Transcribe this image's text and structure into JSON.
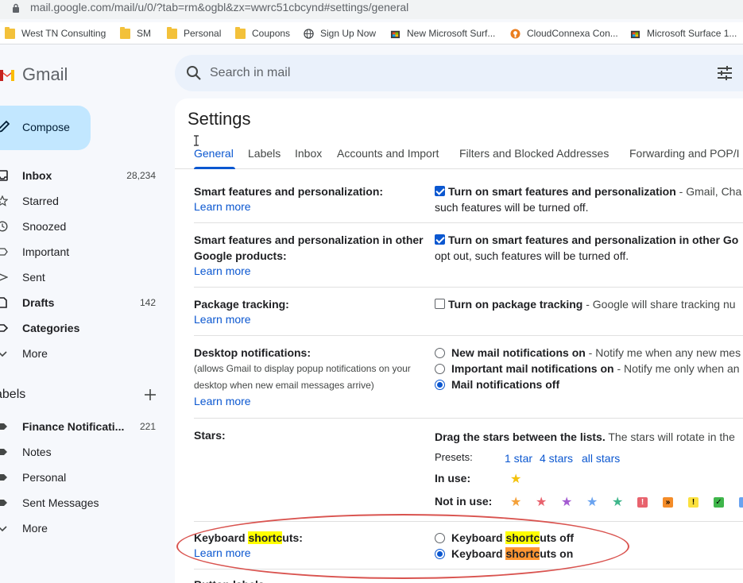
{
  "browser": {
    "url": "mail.google.com/mail/u/0/?tab=rm&ogbl&zx=wwrc51cbcynd#settings/general",
    "bookmarks": [
      {
        "label": "West TN Consulting",
        "icon": "folder-icon"
      },
      {
        "label": "SM",
        "icon": "folder-icon"
      },
      {
        "label": "Personal",
        "icon": "folder-icon"
      },
      {
        "label": "Coupons",
        "icon": "folder-icon"
      },
      {
        "label": "Sign Up Now",
        "icon": "globe-icon"
      },
      {
        "label": "New Microsoft Surf...",
        "icon": "microsoft-store-icon"
      },
      {
        "label": "CloudConnexa Con...",
        "icon": "openvpn-icon"
      },
      {
        "label": "Microsoft Surface 1...",
        "icon": "microsoft-store-icon"
      }
    ]
  },
  "header": {
    "logo_text": "Gmail",
    "search_placeholder": "Search in mail"
  },
  "sidebar": {
    "compose_label": "Compose",
    "items": [
      {
        "label": "Inbox",
        "count": "28,234",
        "bold": true,
        "icon": "inbox-icon"
      },
      {
        "label": "Starred",
        "count": "",
        "bold": false,
        "icon": "star-icon"
      },
      {
        "label": "Snoozed",
        "count": "",
        "bold": false,
        "icon": "clock-icon"
      },
      {
        "label": "Important",
        "count": "",
        "bold": false,
        "icon": "important-icon"
      },
      {
        "label": "Sent",
        "count": "",
        "bold": false,
        "icon": "send-icon"
      },
      {
        "label": "Drafts",
        "count": "142",
        "bold": true,
        "icon": "draft-icon"
      },
      {
        "label": "Categories",
        "count": "",
        "bold": true,
        "icon": "label-icon"
      },
      {
        "label": "More",
        "count": "",
        "bold": false,
        "icon": "chevron-down-icon"
      }
    ],
    "labels_heading": "abels",
    "labels": [
      {
        "label": "Finance Notificati...",
        "count": "221",
        "bold": true
      },
      {
        "label": "Notes",
        "count": "",
        "bold": false
      },
      {
        "label": "Personal",
        "count": "",
        "bold": false
      },
      {
        "label": "Sent Messages",
        "count": "",
        "bold": false
      },
      {
        "label": "More",
        "count": "",
        "bold": false
      }
    ]
  },
  "settings": {
    "title": "Settings",
    "tabs": [
      "General",
      "Labels",
      "Inbox",
      "Accounts and Import",
      "Filters and Blocked Addresses",
      "Forwarding and POP/I"
    ],
    "active_tab": "General",
    "learn_more": "Learn more",
    "smart": {
      "label": "Smart features and personalization:",
      "option_bold": "Turn on smart features and personalization",
      "option_rest": " - Gmail, Cha",
      "line2": "such features will be turned off."
    },
    "smart_other": {
      "label_line1": "Smart features and personalization in other",
      "label_line2": "Google products:",
      "option_bold": "Turn on smart features and personalization in other Go",
      "line2": "opt out, such features will be turned off."
    },
    "package": {
      "label": "Package tracking:",
      "option_bold": "Turn on package tracking",
      "option_rest": " - Google will share tracking nu"
    },
    "desktop": {
      "label": "Desktop notifications:",
      "sub_line1": "(allows Gmail to display popup notifications on your",
      "sub_line2": "desktop when new email messages arrive)",
      "opt1_bold": "New mail notifications on",
      "opt1_rest": " - Notify me when any new mes",
      "opt2_bold": "Important mail notifications on",
      "opt2_rest": " - Notify me only when an",
      "opt3_bold": "Mail notifications off"
    },
    "stars": {
      "label": "Stars:",
      "desc_bold": "Drag the stars between the lists.",
      "desc_rest": "  The stars will rotate in the",
      "presets_label": "Presets:",
      "presets": [
        "1 star",
        "4 stars",
        "all stars"
      ],
      "in_use_label": "In use:",
      "not_in_use_label": "Not in use:",
      "badge_glyphs": [
        "!",
        "»",
        "!",
        "✓"
      ]
    },
    "shortcuts": {
      "label_pre": "Keyboard ",
      "label_hl": "shortc",
      "label_post": "uts:",
      "off_pre": "Keyboard ",
      "off_hl": "shortc",
      "off_post": "uts off",
      "on_pre": "Keyboard ",
      "on_hl": "shortc",
      "on_post": "uts on"
    },
    "next_row_partial": "Button labels"
  }
}
